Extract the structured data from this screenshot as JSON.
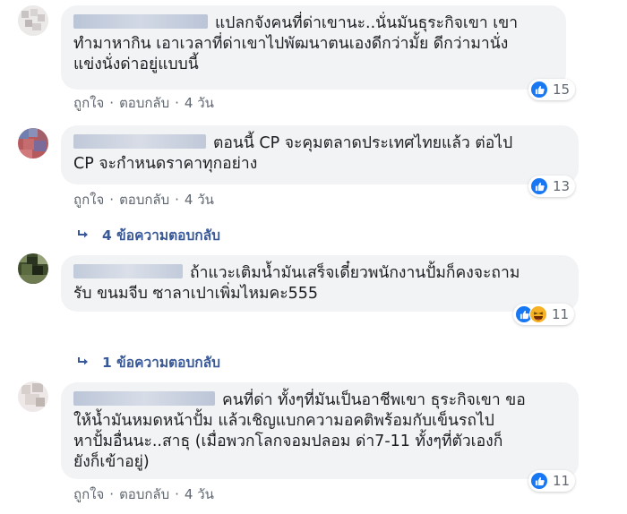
{
  "comments": [
    {
      "text_line1": "แปลกจังคนที่ด่าเขานะ..นั่นมันธุระกิจเขา เขา",
      "text_line2": "ทำมาหากิน เอาเวลาที่ด่าเขาไปพัฒนาตนเองดีกว่ามั้ย ดีกว่ามานั่ง",
      "text_line3": "แข่งนั่งด่าอยู่แบบนี้",
      "like": "ถูกใจ",
      "reply": "ตอบกลับ",
      "time": "4 วัน",
      "reaction_count": "15"
    },
    {
      "text_line1": "ตอนนี้ CP จะคุมตลาดประเทศไทยแล้ว ต่อไป",
      "text_line2": "CP จะกำหนดราคาทุกอย่าง",
      "like": "ถูกใจ",
      "reply": "ตอบกลับ",
      "time": "4 วัน",
      "reaction_count": "13",
      "replies_label": "4 ข้อความตอบกลับ"
    },
    {
      "text_line1": "ถ้าแวะเติมน้ำมันเสร็จเดี๋ยวพนักงานปั้มก็คงจะถาม",
      "text_line2": "รับ ขนมจีบ ซาลาเปาเพิ่มไหมคะ555",
      "reaction_count": "11",
      "replies_label": "1 ข้อความตอบกลับ"
    },
    {
      "text_line1": "คนที่ด่า ทั้งๆที่มันเป็นอาชีพเขา ธุระกิจเขา ขอ",
      "text_line2": "ให้น้ำมันหมดหน้าปั้ม แล้วเชิญแบกความอคติพร้อมกับเข็นรถไป",
      "text_line3": "หาปั้มอื่นนะ..สาธุ (เมื่อพวกโลกจอมปลอม ด่า7-11 ทั้งๆที่ตัวเองก็",
      "text_line4": "ยังก็เข้าอยู่)",
      "like": "ถูกใจ",
      "reply": "ตอบกลับ",
      "time": "4 วัน",
      "reaction_count": "11"
    }
  ],
  "colors": {
    "bubble": "#f2f3f5",
    "link": "#385898",
    "meta": "#606770",
    "like": "#1877f2"
  }
}
